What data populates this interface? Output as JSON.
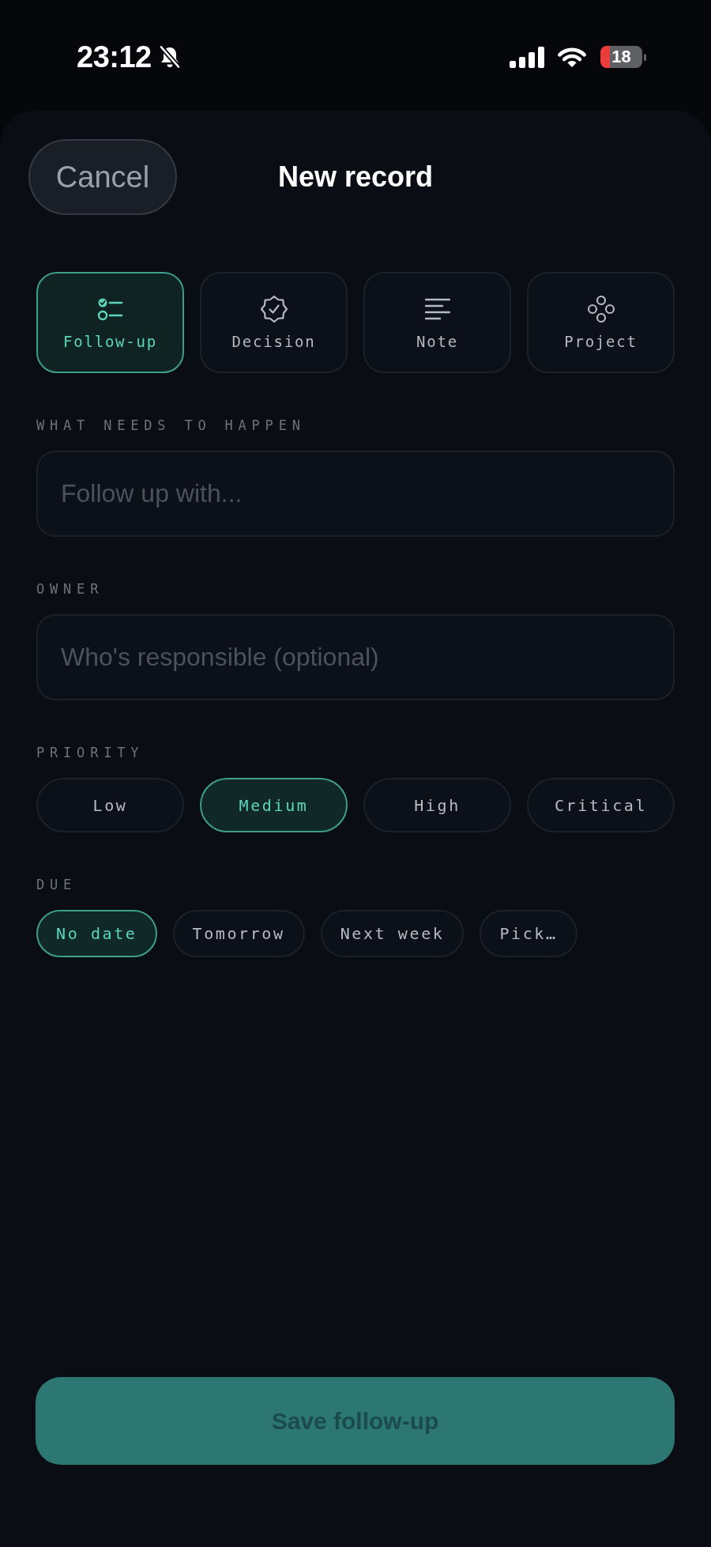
{
  "status_bar": {
    "time": "23:12",
    "battery": "18"
  },
  "header": {
    "cancel_button": "Cancel",
    "title": "New record"
  },
  "types": [
    {
      "label": "Follow-up",
      "kind": "checklist",
      "selected": true
    },
    {
      "label": "Decision",
      "kind": "seal",
      "selected": false
    },
    {
      "label": "Note",
      "kind": "lines",
      "selected": false
    },
    {
      "label": "Project",
      "kind": "circles",
      "selected": false
    }
  ],
  "fields": [
    {
      "label": "WHAT NEEDS TO HAPPEN",
      "placeholder": "Follow up with..."
    },
    {
      "label": "OWNER",
      "placeholder": "Who's responsible (optional)"
    }
  ],
  "priority": {
    "label": "PRIORITY",
    "options": [
      {
        "label": "Low",
        "selected": false
      },
      {
        "label": "Medium",
        "selected": true
      },
      {
        "label": "High",
        "selected": false
      },
      {
        "label": "Critical",
        "selected": false
      }
    ]
  },
  "due": {
    "label": "DUE",
    "options": [
      {
        "label": "No date",
        "selected": true
      },
      {
        "label": "Tomorrow",
        "selected": false
      },
      {
        "label": "Next week",
        "selected": false
      },
      {
        "label": "Pick…",
        "selected": false
      }
    ]
  },
  "save_button": {
    "label": "Save follow-up",
    "disabled": true
  }
}
